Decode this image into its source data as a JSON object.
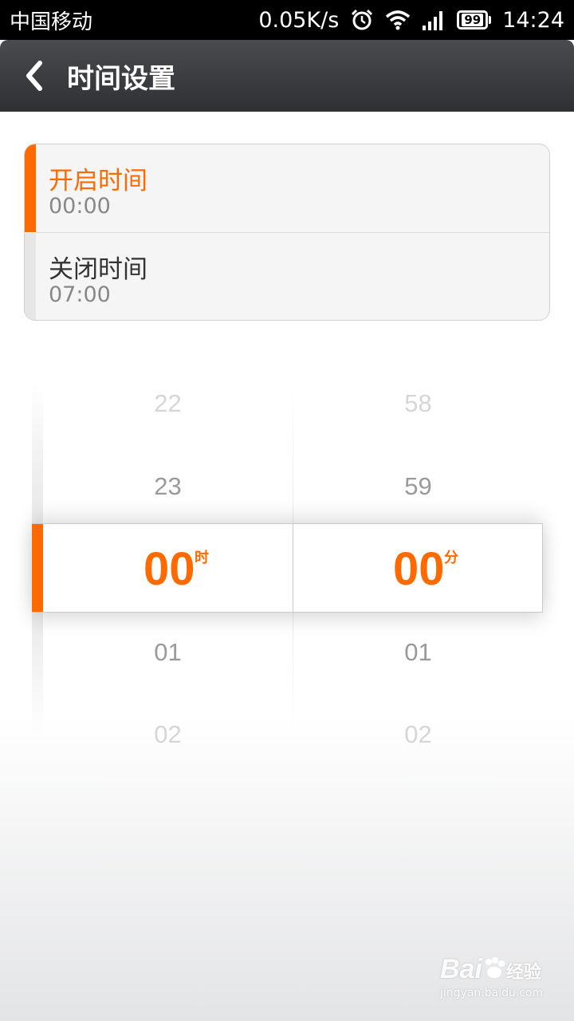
{
  "status_bar": {
    "carrier": "中国移动",
    "speed": "0.05K/s",
    "battery_level": "99",
    "time": "14:24",
    "icons": [
      "alarm-icon",
      "wifi-icon",
      "signal-icon",
      "battery-icon"
    ]
  },
  "header": {
    "back_icon": "chevron-left-icon",
    "title": "时间设置"
  },
  "time_settings": {
    "start": {
      "label": "开启时间",
      "value": "00:00",
      "selected": true
    },
    "end": {
      "label": "关闭时间",
      "value": "07:00",
      "selected": false
    }
  },
  "picker": {
    "hours": {
      "items": [
        "22",
        "23",
        "00",
        "01",
        "02"
      ],
      "selected": "00",
      "unit": "时"
    },
    "minutes": {
      "items": [
        "58",
        "59",
        "00",
        "01",
        "02"
      ],
      "selected": "00",
      "unit": "分"
    }
  },
  "watermark": {
    "brand": "Bai",
    "brand_cn": "经验",
    "url": "jingyan.baidu.com"
  },
  "colors": {
    "accent": "#ff6a00",
    "title_bar": "#3a3b3f"
  }
}
